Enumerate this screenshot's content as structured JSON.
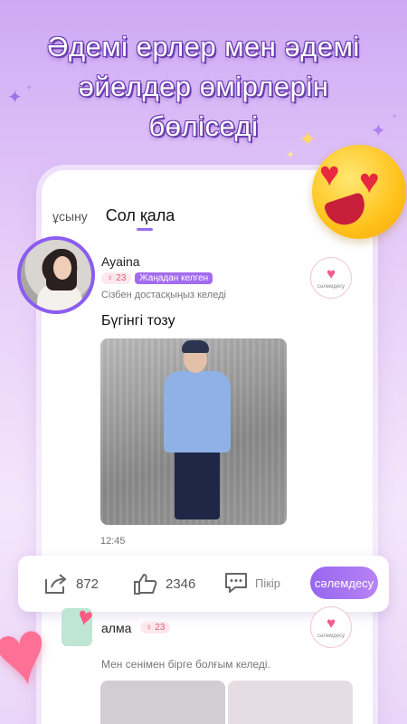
{
  "headline": {
    "line1": "Әдемі ерлер мен әдемі",
    "line2": "әйелдер өмірлерін",
    "line3": "бөліседі"
  },
  "tabs": {
    "recommend": "ұсыну",
    "city": "Сол қала"
  },
  "post": {
    "user_name": "Ayaina",
    "age": "23",
    "age_icon": "female-symbol-icon",
    "new_badge": "Жаңадан келген",
    "status": "Сізбен достасқыңыз келеді",
    "greet_label": "сәлемдесу",
    "text": "Бүгінгі тозу",
    "time": "12:45"
  },
  "actions": {
    "shares": "872",
    "likes": "2346",
    "comment_label": "Пікір",
    "greet_cta": "сәлемдесу"
  },
  "post2": {
    "user_name": "алма",
    "age": "23",
    "status": "Мен сенімен бірге болғым келеді.",
    "greet_label": "сәлемдесу"
  },
  "colors": {
    "accent": "#9766f0",
    "heart": "#f05c8e"
  }
}
